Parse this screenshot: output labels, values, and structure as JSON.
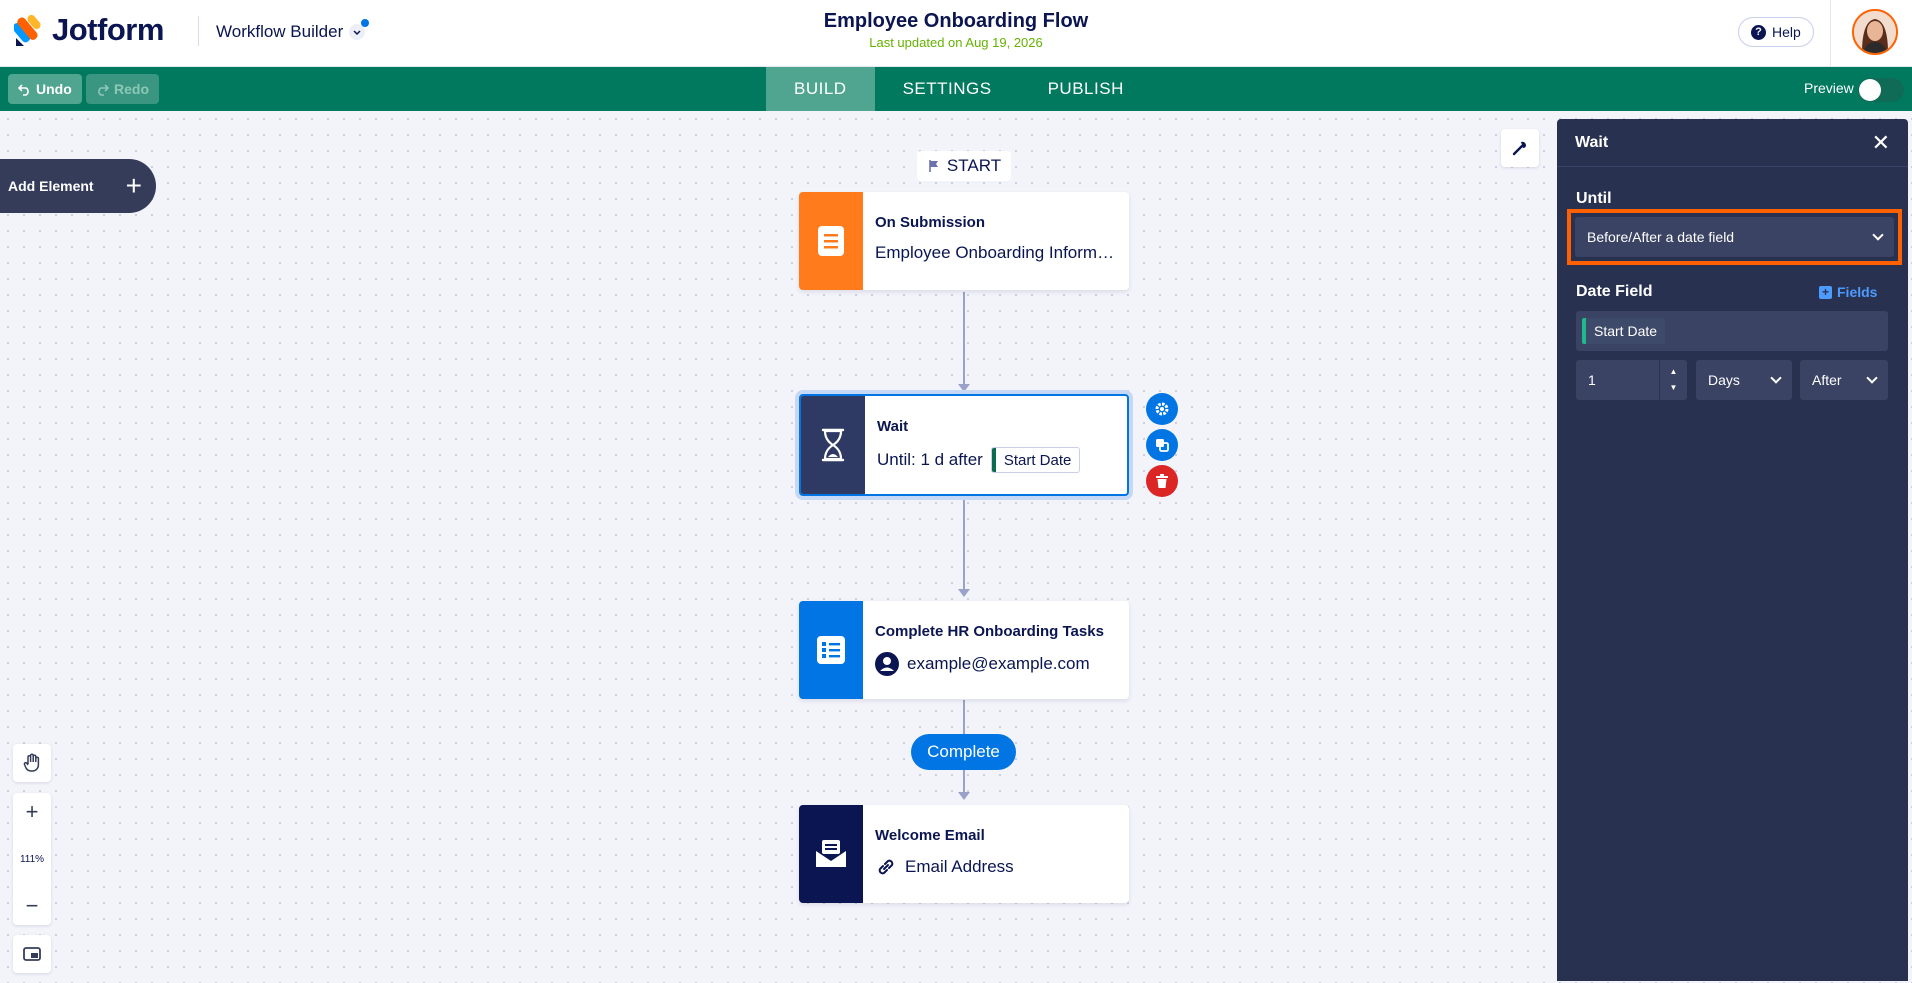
{
  "header": {
    "logo_text": "Jotform",
    "app_name": "Workflow Builder",
    "title": "Employee Onboarding Flow",
    "last_updated": "Last updated on Aug 19, 2026",
    "help_label": "Help"
  },
  "toolbar": {
    "undo_label": "Undo",
    "redo_label": "Redo",
    "tabs": [
      {
        "label": "BUILD",
        "active": true
      },
      {
        "label": "SETTINGS",
        "active": false
      },
      {
        "label": "PUBLISH",
        "active": false
      }
    ],
    "preview_label": "Preview"
  },
  "canvas": {
    "add_element_label": "Add Element",
    "start_label": "START",
    "nodes": [
      {
        "title": "On Submission",
        "subtitle": "Employee Onboarding Information Form",
        "color": "#ff7b1c"
      },
      {
        "title": "Wait",
        "subtitle": "Until: 1 d after",
        "field": "Start Date",
        "color": "#2f3a64"
      },
      {
        "title": "Complete HR Onboarding Tasks",
        "subtitle": "example@example.com",
        "color": "#0075e3"
      },
      {
        "title": "Welcome Email",
        "subtitle": "Email Address",
        "color": "#0a1551"
      }
    ],
    "complete_label": "Complete",
    "zoom_level": "111%"
  },
  "panel": {
    "title": "Wait",
    "until_label": "Until",
    "until_value": "Before/After a date field",
    "date_field_label": "Date Field",
    "fields_link": "Fields",
    "date_field_value": "Start Date",
    "amount": "1",
    "unit": "Days",
    "direction": "After"
  },
  "colors": {
    "brand_green": "#00795f",
    "accent_blue": "#0075e3",
    "highlight_orange": "#ff6100",
    "panel_bg": "#293150"
  }
}
